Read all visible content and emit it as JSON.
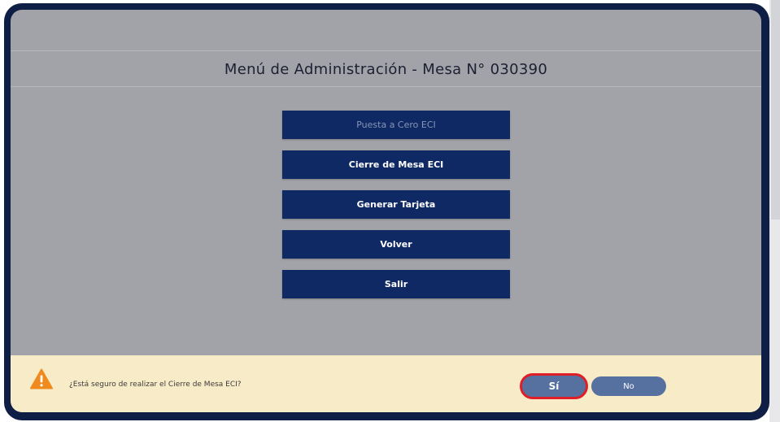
{
  "header": {
    "title": "Menú de Administración - Mesa N° 030390"
  },
  "menu": {
    "items": [
      {
        "label": "Puesta a Cero ECI",
        "enabled": false
      },
      {
        "label": "Cierre de Mesa ECI",
        "enabled": true
      },
      {
        "label": "Generar Tarjeta",
        "enabled": true
      },
      {
        "label": "Volver",
        "enabled": true
      },
      {
        "label": "Salir",
        "enabled": true
      }
    ]
  },
  "confirm": {
    "icon": "warning-icon",
    "message": "¿Está seguro de realizar el Cierre de Mesa ECI?",
    "yes_label": "Sí",
    "no_label": "No"
  },
  "colors": {
    "frame": "#0f1e45",
    "screen_bg": "#a2a3a8",
    "menu_button": "#0e2963",
    "confirm_bar": "#f8ecc8",
    "dialog_button": "#56709f",
    "highlight_ring": "#e01e28",
    "warning": "#ef8a1e"
  }
}
